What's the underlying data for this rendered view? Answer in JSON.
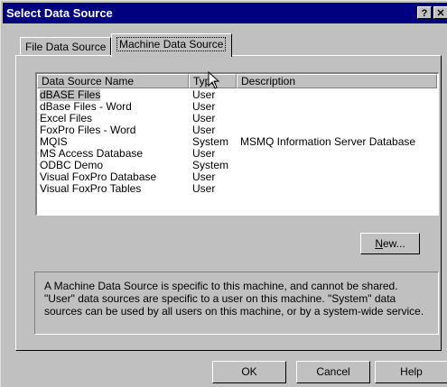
{
  "window": {
    "title": "Select Data Source",
    "help_button": "?",
    "close_button": "✕"
  },
  "tabs": [
    {
      "label": "File Data Source",
      "active": false
    },
    {
      "label": "Machine Data Source",
      "active": true
    }
  ],
  "list": {
    "columns": [
      "Data Source Name",
      "Type",
      "Description"
    ],
    "rows": [
      {
        "name": "dBASE Files",
        "type": "User",
        "description": "",
        "selected": true
      },
      {
        "name": "dBase Files - Word",
        "type": "User",
        "description": ""
      },
      {
        "name": "Excel Files",
        "type": "User",
        "description": ""
      },
      {
        "name": "FoxPro Files - Word",
        "type": "User",
        "description": ""
      },
      {
        "name": "MQIS",
        "type": "System",
        "description": "MSMQ Information Server Database"
      },
      {
        "name": "MS Access Database",
        "type": "User",
        "description": ""
      },
      {
        "name": "ODBC Demo",
        "type": "System",
        "description": ""
      },
      {
        "name": "Visual FoxPro Database",
        "type": "User",
        "description": ""
      },
      {
        "name": "Visual FoxPro Tables",
        "type": "User",
        "description": ""
      }
    ]
  },
  "new_button": {
    "label_underlined": "N",
    "label_rest": "ew..."
  },
  "description": {
    "line1": "A Machine Data Source is specific to this machine, and cannot be shared.",
    "line2": "\"User\" data sources are specific to a user on this machine.  \"System\" data",
    "line3": "sources can be used by all users on this machine, or by a system-wide service."
  },
  "footer": {
    "ok_label": "OK",
    "cancel_label": "Cancel",
    "help_label": "Help"
  }
}
